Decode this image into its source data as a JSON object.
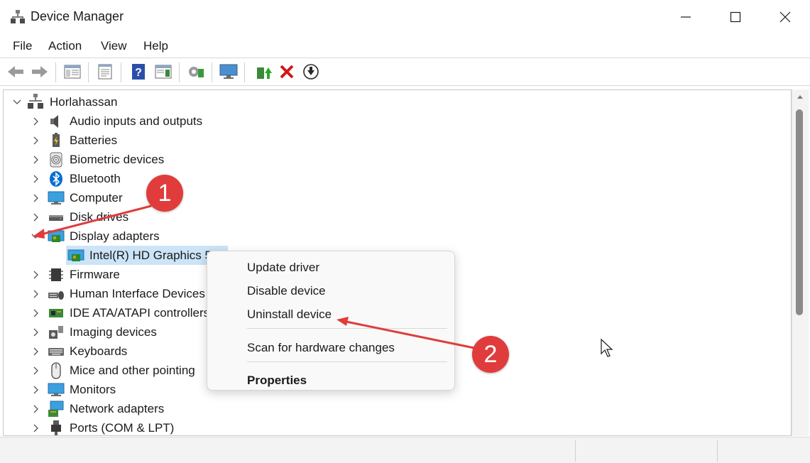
{
  "window": {
    "title": "Device Manager",
    "controls": {
      "minimize": "minimize",
      "maximize": "maximize",
      "close": "close"
    }
  },
  "menu": {
    "items": [
      "File",
      "Action",
      "View",
      "Help"
    ]
  },
  "toolbar": {
    "buttons": [
      "back-icon",
      "forward-icon",
      "show-hide-console-tree-icon",
      "properties-icon",
      "help-icon",
      "action-pane-icon",
      "scan-hardware-icon",
      "monitor-icon",
      "update-driver-icon",
      "uninstall-icon",
      "download-icon"
    ]
  },
  "tree": {
    "root": "Horlahassan",
    "items": [
      {
        "label": "Audio inputs and outputs",
        "icon": "speaker-icon"
      },
      {
        "label": "Batteries",
        "icon": "battery-icon"
      },
      {
        "label": "Biometric devices",
        "icon": "fingerprint-icon"
      },
      {
        "label": "Bluetooth",
        "icon": "bluetooth-icon"
      },
      {
        "label": "Computer",
        "icon": "computer-icon"
      },
      {
        "label": "Disk drives",
        "icon": "disk-drive-icon"
      },
      {
        "label": "Display adapters",
        "icon": "display-adapter-icon",
        "expanded": true
      },
      {
        "label": "Intel(R) HD Graphics 5",
        "icon": "display-adapter-icon",
        "child": true,
        "selected": true
      },
      {
        "label": "Firmware",
        "icon": "firmware-icon"
      },
      {
        "label": "Human Interface Devices",
        "icon": "hid-icon"
      },
      {
        "label": "IDE ATA/ATAPI controllers",
        "icon": "ide-controller-icon"
      },
      {
        "label": "Imaging devices",
        "icon": "camera-icon"
      },
      {
        "label": "Keyboards",
        "icon": "keyboard-icon"
      },
      {
        "label": "Mice and other pointing",
        "icon": "mouse-icon"
      },
      {
        "label": "Monitors",
        "icon": "monitor-icon"
      },
      {
        "label": "Network adapters",
        "icon": "network-adapter-icon"
      },
      {
        "label": "Ports (COM & LPT)",
        "icon": "port-icon"
      }
    ]
  },
  "context_menu": {
    "items": [
      "Update driver",
      "Disable device",
      "Uninstall device",
      "Scan for hardware changes",
      "Properties"
    ]
  },
  "annotations": {
    "badge_1": "1",
    "badge_2": "2",
    "color": "#e03c3c"
  },
  "colors": {
    "selection": "#cce4f7",
    "accent": "#0078d4"
  }
}
